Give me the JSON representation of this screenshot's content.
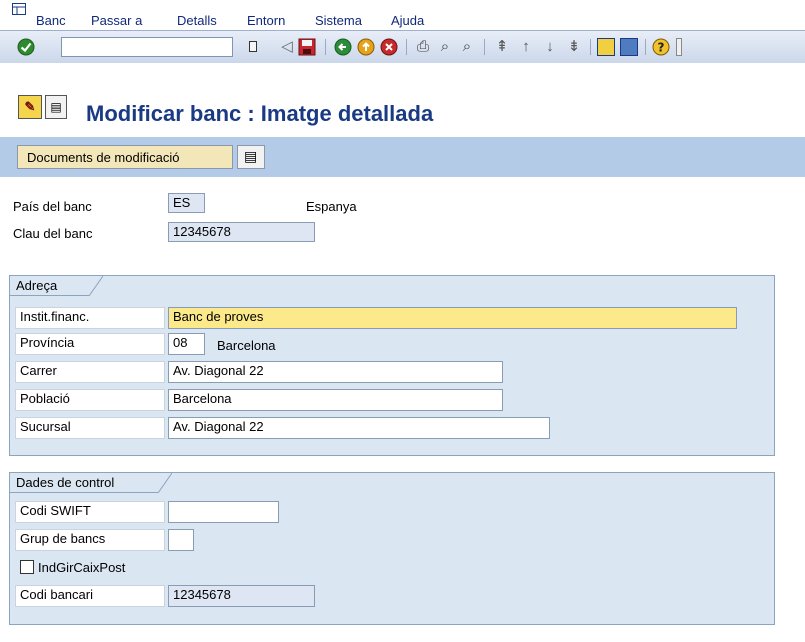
{
  "menubar": {
    "items": [
      "Banc",
      "Passar a",
      "Detalls",
      "Entorn",
      "Sistema",
      "Ajuda"
    ]
  },
  "toolbar": {
    "command_value": ""
  },
  "page": {
    "title": "Modificar banc : Imatge detallada"
  },
  "appbar": {
    "change_docs_label": "Documents de modificació"
  },
  "header_fields": {
    "country_label": "País del banc",
    "country_value": "ES",
    "country_name": "Espanya",
    "bank_key_label": "Clau del banc",
    "bank_key_value": "12345678"
  },
  "address": {
    "group_title": "Adreça",
    "institution_label": "Instit.financ.",
    "institution_value": "Banc de proves",
    "province_label": "Província",
    "province_code": "08",
    "province_name": "Barcelona",
    "street_label": "Carrer",
    "street_value": "Av. Diagonal 22",
    "city_label": "Població",
    "city_value": "Barcelona",
    "branch_label": "Sucursal",
    "branch_value": "Av. Diagonal 22"
  },
  "control": {
    "group_title": "Dades de control",
    "swift_label": "Codi SWIFT",
    "swift_value": "",
    "bank_group_label": "Grup de bancs",
    "bank_group_value": "",
    "postbank_label": "IndGirCaixPost",
    "bank_code_label": "Codi bancari",
    "bank_code_value": "12345678"
  }
}
